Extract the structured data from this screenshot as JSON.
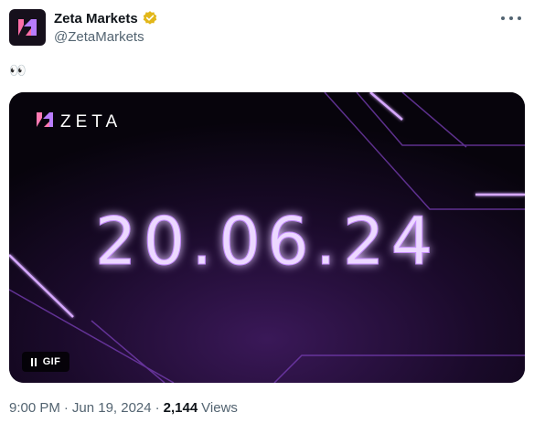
{
  "author": {
    "display_name": "Zeta Markets",
    "handle": "@ZetaMarkets",
    "verified": true,
    "verified_color": "#e2b719"
  },
  "tweet": {
    "text": "👀"
  },
  "media": {
    "brand_name": "ZETA",
    "headline_date": "20.06.24",
    "badge_label": "GIF",
    "accent_color": "#c58bff"
  },
  "meta": {
    "time": "9:00 PM",
    "separator": "·",
    "date": "Jun 19, 2024",
    "views_count": "2,144",
    "views_label": "Views"
  }
}
